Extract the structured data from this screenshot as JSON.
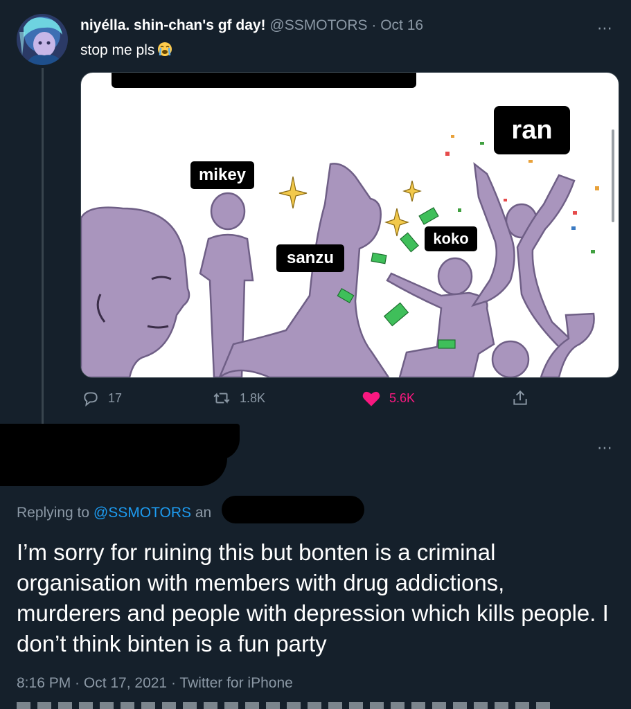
{
  "tweet1": {
    "author_name": "niyélla. shin-chan's gf day!",
    "handle": "@SSMOTORS",
    "separator": "·",
    "date": "Oct 16",
    "text": "stop me pls",
    "emoji": "loudly-crying-face",
    "media_labels": {
      "mikey": "mikey",
      "sanzu": "sanzu",
      "koko": "koko",
      "ran": "ran"
    },
    "actions": {
      "replies": "17",
      "retweets": "1.8K",
      "likes": "5.6K",
      "liked": true
    },
    "more_icon": "⋯"
  },
  "tweet2": {
    "more_icon": "⋯",
    "replying_prefix": "Replying to ",
    "replying_handle": "@SSMOTORS",
    "replying_suffix": " an",
    "text": "I’m sorry for ruining this but bonten is a criminal organisation with members with drug addictions, murderers and people with depression which kills people. I don’t think binten is a fun party",
    "meta": "8:16 PM · Oct 17, 2021 · Twitter for iPhone"
  },
  "colors": {
    "background": "#15202b",
    "secondary_text": "#8b98a5",
    "link": "#1d9bf0",
    "like": "#f91880",
    "figure_purple": "#a995bd"
  }
}
